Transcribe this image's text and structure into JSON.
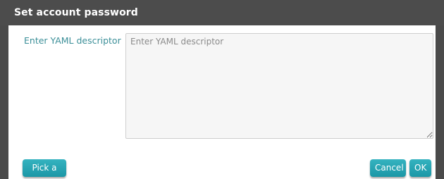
{
  "dialog": {
    "title": "Set account password"
  },
  "form": {
    "yaml_label": "Enter YAML descriptor",
    "yaml_placeholder": "Enter YAML descriptor",
    "yaml_value": ""
  },
  "buttons": {
    "pick_file": "Pick a file",
    "cancel": "Cancel",
    "ok": "OK"
  },
  "colors": {
    "titlebar": "#4c4c4c",
    "accent": "#1c97a6",
    "label": "#3b8f98"
  }
}
